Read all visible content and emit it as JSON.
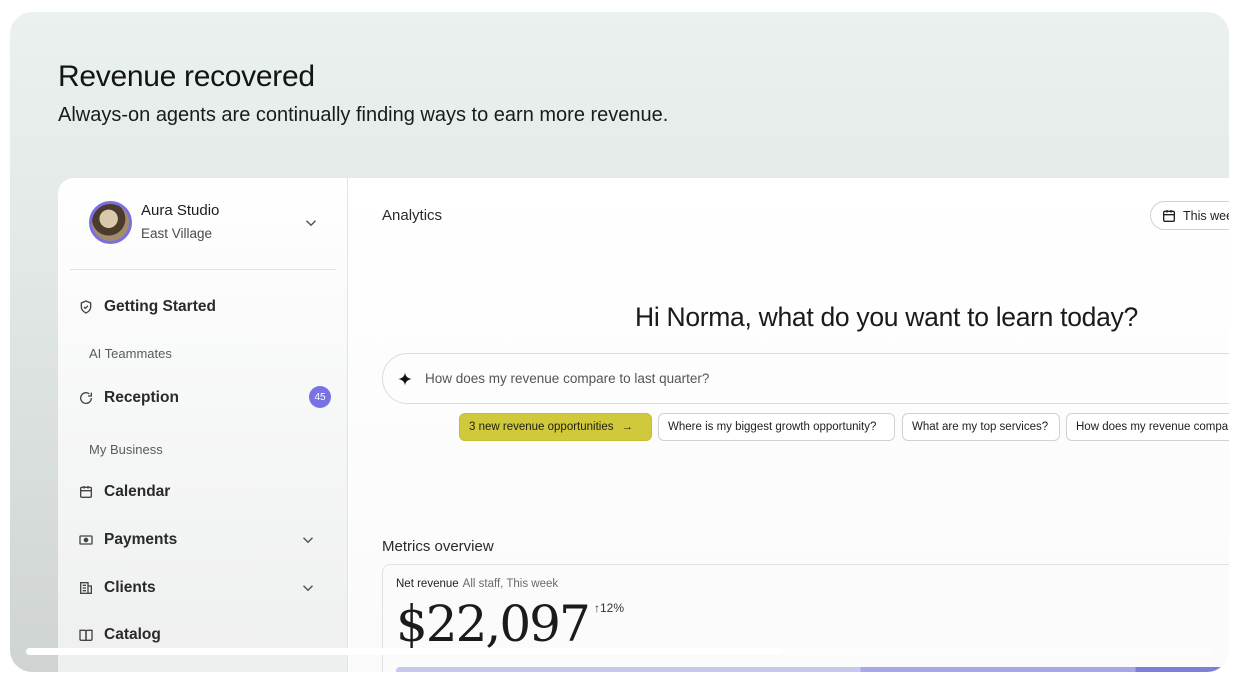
{
  "hero": {
    "title": "Revenue recovered",
    "subtitle": "Always-on agents are continually finding ways to earn more revenue."
  },
  "business": {
    "name": "Aura Studio",
    "location": "East Village",
    "avatar_icon": "business-avatar"
  },
  "sidebar": {
    "getting_started": "Getting Started",
    "sections": {
      "ai_teammates": "AI Teammates",
      "my_business": "My Business"
    },
    "items": [
      {
        "label": "Reception",
        "icon": "refresh-icon",
        "badge": "45"
      },
      {
        "label": "Calendar",
        "icon": "calendar-icon"
      },
      {
        "label": "Payments",
        "icon": "payments-icon"
      },
      {
        "label": "Clients",
        "icon": "clients-icon"
      },
      {
        "label": "Catalog",
        "icon": "book-icon"
      }
    ]
  },
  "main": {
    "title": "Analytics",
    "date_range": "This wee",
    "greeting": "Hi Norma, what do you want to learn today?",
    "ask_placeholder": "How does my revenue compare to last quarter?",
    "chips": [
      "3 new revenue opportunities",
      "Where is my biggest growth opportunity?",
      "What are my top services?",
      "How does my revenue compa"
    ],
    "metrics_title": "Metrics overview",
    "metric": {
      "label": "Net revenue",
      "scope": "All staff, This week",
      "value": "$22,097",
      "delta": "12%"
    }
  },
  "colors": {
    "accent": "#7a71e2",
    "chip_primary": "#d1c93c"
  }
}
